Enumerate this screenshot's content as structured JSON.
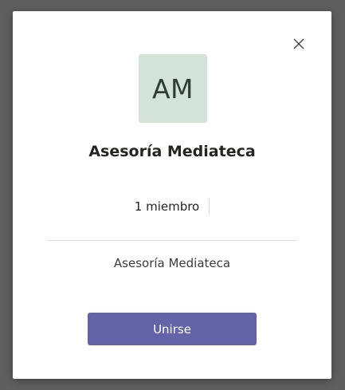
{
  "dialog": {
    "avatar_initials": "AM",
    "avatar_color": "#d3e3d9",
    "team_name": "Asesoría Mediateca",
    "member_count": "1 miembro",
    "description": "Asesoría Mediateca",
    "join_label": "Unirse",
    "join_color": "#6264a7",
    "close_icon": "close-icon"
  }
}
